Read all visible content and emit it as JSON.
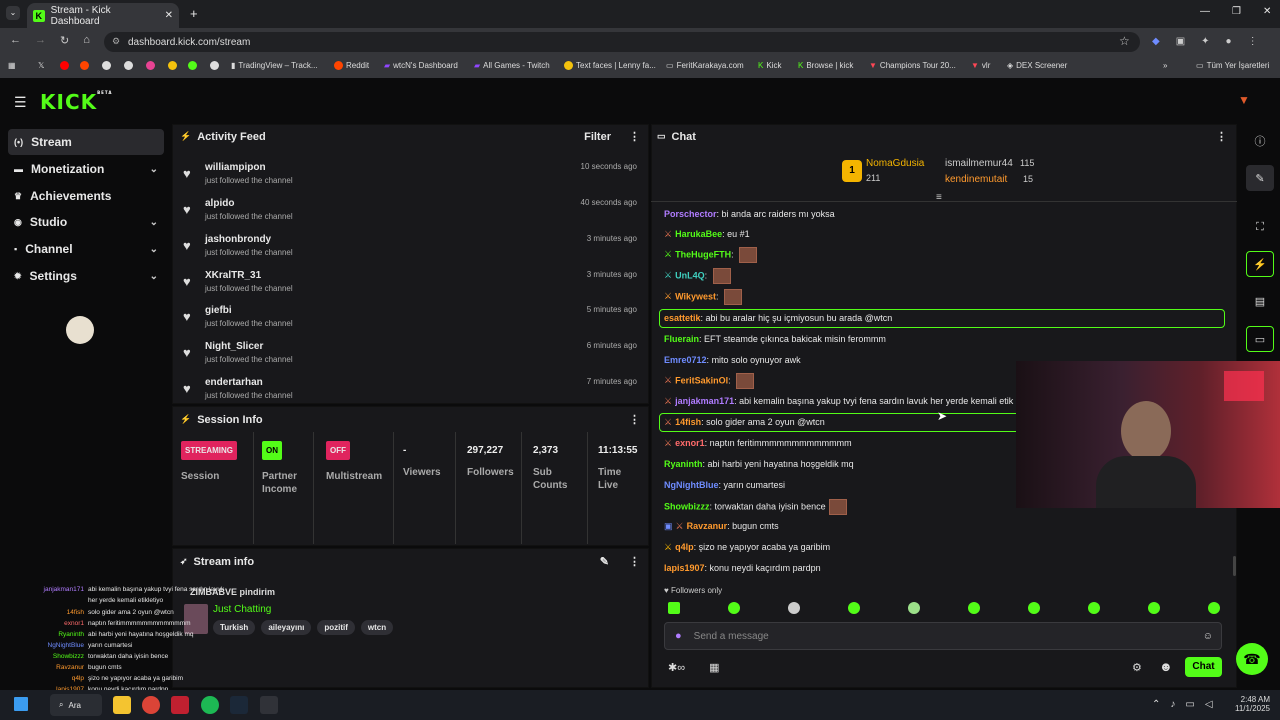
{
  "browser": {
    "tab_title": "Stream - Kick Dashboard",
    "url": "dashboard.kick.com/stream",
    "bookmarks": [
      "TradingView – Track...",
      "Reddit",
      "wtcN's Dashboard",
      "All Games - Twitch",
      "Text faces | Lenny fa...",
      "FeritKarakaya.com",
      "Kick",
      "Browse | kick",
      "Champions Tour 20...",
      "vlr",
      "DEX Screener"
    ],
    "bookmarks_folder": "Tüm Yer İşaretleri"
  },
  "kick": {
    "logo": "KICK",
    "beta": "BETA"
  },
  "sidebar": {
    "items": [
      {
        "label": "Stream",
        "icon": "broadcast-icon"
      },
      {
        "label": "Monetization",
        "icon": "money-icon"
      },
      {
        "label": "Achievements",
        "icon": "trophy-icon"
      },
      {
        "label": "Studio",
        "icon": "studio-icon"
      },
      {
        "label": "Channel",
        "icon": "channel-icon"
      },
      {
        "label": "Settings",
        "icon": "gear-icon"
      }
    ]
  },
  "activity": {
    "title": "Activity Feed",
    "filter": "Filter",
    "items": [
      {
        "name": "williampipon",
        "sub": "just followed the channel",
        "time": "10 seconds ago"
      },
      {
        "name": "alpido",
        "sub": "just followed the channel",
        "time": "40 seconds ago"
      },
      {
        "name": "jashonbrondy",
        "sub": "just followed the channel",
        "time": "3 minutes ago"
      },
      {
        "name": "XKralTR_31",
        "sub": "just followed the channel",
        "time": "3 minutes ago"
      },
      {
        "name": "giefbi",
        "sub": "just followed the channel",
        "time": "5 minutes ago"
      },
      {
        "name": "Night_Slicer",
        "sub": "just followed the channel",
        "time": "6 minutes ago"
      },
      {
        "name": "endertarhan",
        "sub": "just followed the channel",
        "time": "7 minutes ago"
      }
    ]
  },
  "session": {
    "title": "Session Info",
    "streaming": "STREAMING",
    "session_label": "Session",
    "on": "ON",
    "partner": "Partner Income",
    "off": "OFF",
    "multistream": "Multistream",
    "viewers_val": "-",
    "viewers": "Viewers",
    "followers_val": "297,227",
    "followers": "Followers",
    "subs_val": "2,373",
    "subs": "Sub Counts",
    "time_val": "11:13:55",
    "time": "Time Live"
  },
  "streaminfo": {
    "title": "Stream info",
    "stream_title": "ZIMBABVE pindirim",
    "category": "Just Chatting",
    "tags": [
      "Turkish",
      "aileyayını",
      "pozitif",
      "wtcn"
    ]
  },
  "chat": {
    "title": "Chat",
    "top": [
      {
        "name": "NomaGdusia",
        "count": "211"
      },
      {
        "name": "ismailmemur44",
        "count": "115"
      },
      {
        "name": "kendinemutait",
        "count": "15"
      }
    ],
    "messages": [
      {
        "user": "Porschector",
        "color": "#b07cff",
        "text": "bi anda arc raiders mı yoksa"
      },
      {
        "user": "HarukaBee",
        "color": "#53fc18",
        "text": "eu #1"
      },
      {
        "user": "TheHugeFTH",
        "color": "#53fc18",
        "text": ""
      },
      {
        "user": "UnL4Q",
        "color": "#3fd0c0",
        "text": ""
      },
      {
        "user": "Wikywest",
        "color": "#ff9a2e",
        "text": ""
      },
      {
        "user": "esattetik",
        "color": "#ff9a2e",
        "text": "abi bu aralar hiç şu içmiyosun bu arada @wtcn"
      },
      {
        "user": "Fluerain",
        "color": "#53fc18",
        "text": "EFT steamde çıkınca bakicak misin ferommm"
      },
      {
        "user": "Emre0712",
        "color": "#6f8cff",
        "text": "mito solo oynuyor awk"
      },
      {
        "user": "FeritSakinOl",
        "color": "#ff9a2e",
        "text": ""
      },
      {
        "user": "janjakman171",
        "color": "#b07cff",
        "text": "abi kemalin başına yakup tvyi fena sardın lavuk her yerde kemali etik"
      },
      {
        "user": "14fish",
        "color": "#ff9a2e",
        "text": "solo gider ama 2 oyun @wtcn"
      },
      {
        "user": "exnor1",
        "color": "#ff6b6b",
        "text": "naptın feritimmmmmmmmmmmmm"
      },
      {
        "user": "Ryaninth",
        "color": "#53fc18",
        "text": "abi harbi yeni hayatına hoşgeldik mq"
      },
      {
        "user": "NgNightBlue",
        "color": "#6f8cff",
        "text": "yarın cumartesi"
      },
      {
        "user": "Showbizzz",
        "color": "#53fc18",
        "text": "torwaktan daha iyisin bence"
      },
      {
        "user": "Ravzanur",
        "color": "#ff9a2e",
        "text": "bugun cmts"
      },
      {
        "user": "q4lp",
        "color": "#ff9a2e",
        "text": "şizo ne yapıyor acaba ya garibim"
      },
      {
        "user": "lapis1907",
        "color": "#ff9a2e",
        "text": "konu neydi kaçırdım pardpn"
      }
    ],
    "followers_only": "Followers only",
    "placeholder": "Send a message",
    "send": "Chat"
  },
  "overlay": [
    {
      "user": "janjakman171",
      "text": "abi kemalin başına yakup tvyi fena sardın lavuk"
    },
    {
      "user": "",
      "text": "her yerde kemali etikletiyo"
    },
    {
      "user": "14fish",
      "text": "solo gider ama 2 oyun @wtcn"
    },
    {
      "user": "exnor1",
      "text": "naptın feritimmmmmmmmmmmmm"
    },
    {
      "user": "Ryaninth",
      "text": "abi harbi yeni hayatına hoşgeldik mq"
    },
    {
      "user": "NgNightBlue",
      "text": "yarın cumartesi"
    },
    {
      "user": "Showbizzz",
      "text": "torwaktan daha iyisin bence"
    },
    {
      "user": "Ravzanur",
      "text": "bugun cmts"
    },
    {
      "user": "q4lp",
      "text": "şizo ne yapıyor acaba ya garibim"
    },
    {
      "user": "lapis1907",
      "text": "konu neydi kaçırdım pardpn"
    }
  ],
  "taskbar": {
    "search": "Ara",
    "time": "2:48 AM",
    "date": "11/1/2025"
  }
}
